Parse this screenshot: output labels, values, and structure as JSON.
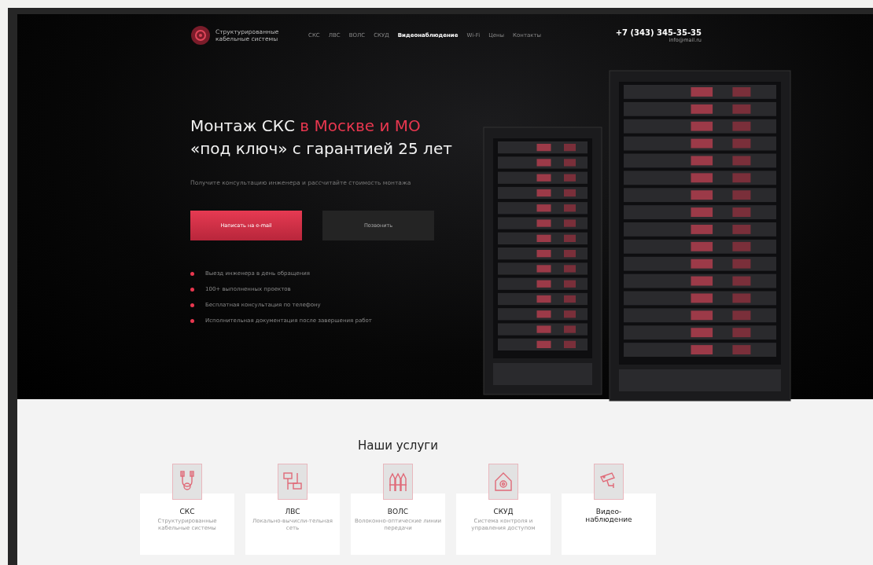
{
  "header": {
    "logo_text": "Структурированные кабельные системы",
    "nav": [
      {
        "label": "СКС",
        "selected": false
      },
      {
        "label": "ЛВС",
        "selected": false
      },
      {
        "label": "ВОЛС",
        "selected": false
      },
      {
        "label": "СКУД",
        "selected": false
      },
      {
        "label": "Видеонаблюдение",
        "selected": true
      },
      {
        "label": "Wi-Fi",
        "selected": false
      },
      {
        "label": "Цены",
        "selected": false
      },
      {
        "label": "Контакты",
        "selected": false
      }
    ],
    "phone": "+7 (343) 345-35-35",
    "email": "info@mail.ru"
  },
  "hero": {
    "title_line1": "Монтаж СКС",
    "title_accent": "в Москве и МО",
    "title_line2": "«под ключ» с гарантией 25 лет",
    "subtitle": "Получите консультацию инженера и рассчитайте стоимость монтажа",
    "buttons": [
      {
        "label": "Написать на e-mail",
        "kind": "primary"
      },
      {
        "label": "Позвонить",
        "kind": "secondary"
      }
    ],
    "bullets": [
      "Выезд инженера в день обращения",
      "100+ выполненных проектов",
      "Бесплатная консультация по телефону",
      "Исполнительная документация после завершения работ"
    ]
  },
  "services": {
    "title": "Наши услуги",
    "items": [
      {
        "name": "СКС",
        "description": "Структурированные кабельные системы",
        "kind": "cable"
      },
      {
        "name": "ЛВС",
        "description": "Локально-вычисли-тельная сеть",
        "kind": "network"
      },
      {
        "name": "ВОЛС",
        "description": "Волоконно-оптические линии передачи",
        "kind": "fiber"
      },
      {
        "name": "СКУД",
        "description": "Система контроля и управления доступом",
        "kind": "access"
      },
      {
        "name": "Видео-наблюдение",
        "kind": "camera"
      }
    ]
  }
}
